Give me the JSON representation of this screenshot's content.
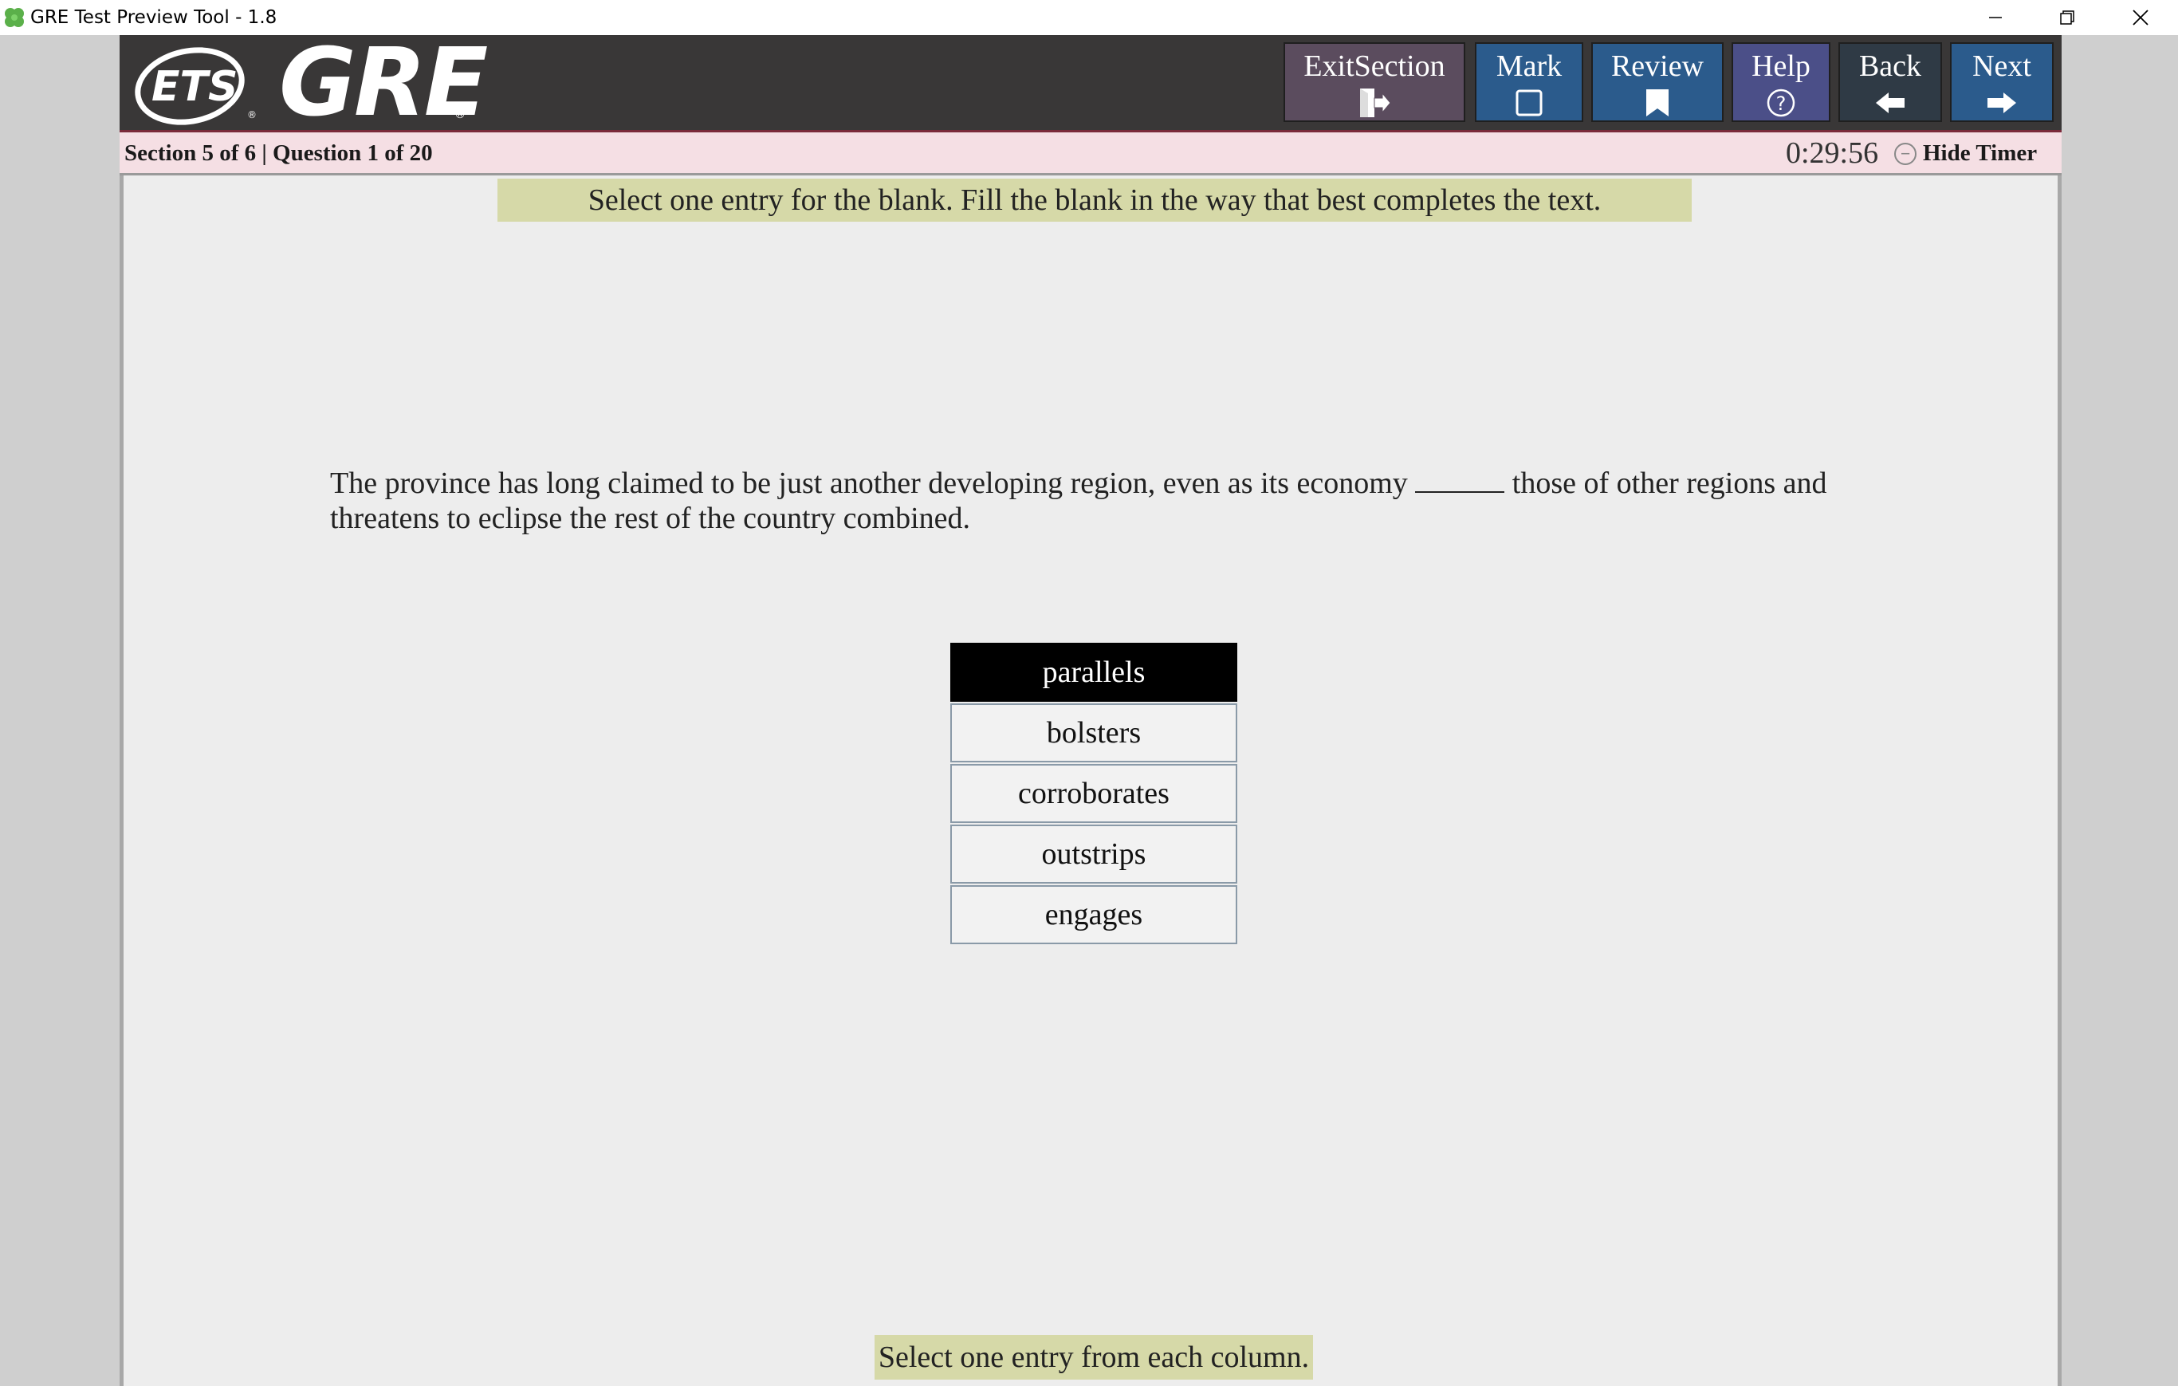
{
  "window": {
    "title": "GRE Test Preview Tool - 1.8",
    "app_icon": "clover-icon"
  },
  "header": {
    "logo_ets": "ETS",
    "logo_gre": "GRE",
    "registered": "®",
    "buttons": {
      "exit_section": "ExitSection",
      "mark": "Mark",
      "review": "Review",
      "help": "Help",
      "back": "Back",
      "next": "Next"
    }
  },
  "status": {
    "section_info": "Section 5 of 6 | Question 1 of 20",
    "timer": "0:29:56",
    "hide_timer": "Hide Timer"
  },
  "main": {
    "instruction": "Select one entry for the blank. Fill the blank in the way that best completes the text.",
    "question_before": "The province has long claimed to be just another developing region, even as its economy",
    "question_after": "those of other regions and threatens to eclipse the rest of the country combined.",
    "choices": [
      "parallels",
      "bolsters",
      "corroborates",
      "outstrips",
      "engages"
    ],
    "selected_choice": "parallels",
    "bottom_note": "Select one entry from each column."
  },
  "colors": {
    "header_bg": "#393737",
    "status_bg": "#f5dfe4",
    "instruction_bg": "#d6d9a8",
    "button_blue": "#2b5b8c",
    "selected_choice_bg": "#000000"
  }
}
